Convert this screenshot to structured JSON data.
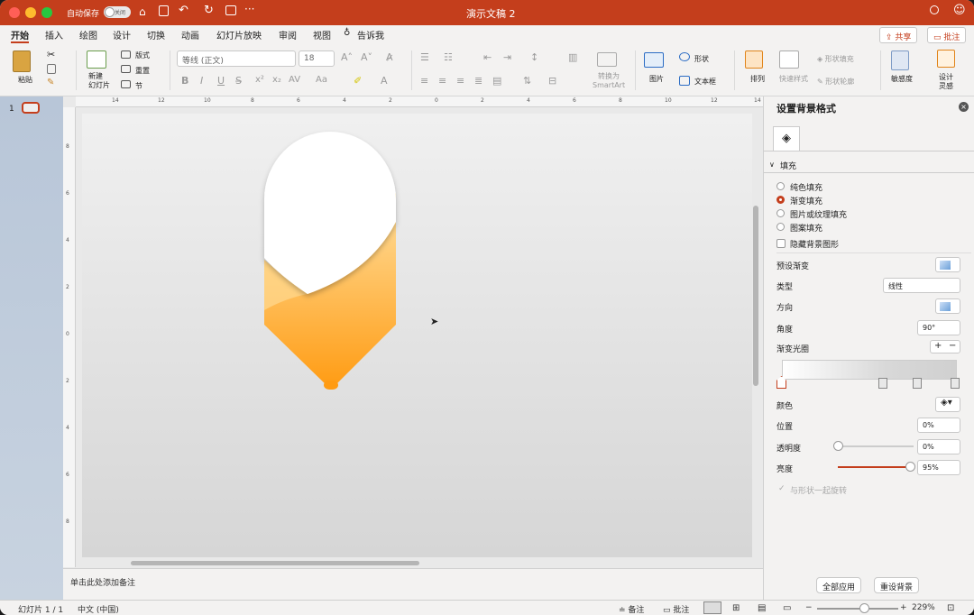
{
  "titlebar": {
    "autosave_label": "自动保存",
    "autosave_state": "关闭",
    "document_title": "演示文稿 2"
  },
  "tabs": [
    "开始",
    "插入",
    "绘图",
    "设计",
    "切换",
    "动画",
    "幻灯片放映",
    "审阅",
    "视图",
    "告诉我"
  ],
  "actions": {
    "share": "共享",
    "comments": "批注"
  },
  "ribbon": {
    "paste": "粘贴",
    "new_slide": "新建\n幻灯片",
    "layout": "版式",
    "reset": "重置",
    "section": "节",
    "font_name": "等线 (正文)",
    "font_size": "18",
    "convert_smartart": "转换为\nSmartArt",
    "picture": "图片",
    "shape": "形状",
    "textbox": "文本框",
    "arrange": "排列",
    "quick_styles": "快速样式",
    "shape_fill": "形状填充",
    "shape_outline": "形状轮廓",
    "sensitivity": "敏感度",
    "designer": "设计\n灵感"
  },
  "thumbnail_number": "1",
  "ruler_top": [
    "14",
    "12",
    "10",
    "8",
    "6",
    "4",
    "2",
    "0",
    "2",
    "4",
    "6",
    "8",
    "10",
    "12",
    "14"
  ],
  "ruler_left": [
    "8",
    "6",
    "4",
    "2",
    "0",
    "2",
    "4",
    "6",
    "8"
  ],
  "notes_placeholder": "单击此处添加备注",
  "format_pane": {
    "title": "设置背景格式",
    "section": "填充",
    "fill_options": [
      "纯色填充",
      "渐变填充",
      "图片或纹理填充",
      "图案填充"
    ],
    "selected_fill": "渐变填充",
    "hide_bg": "隐藏背景图形",
    "preset_gradient": "预设渐变",
    "type_label": "类型",
    "type_value": "线性",
    "direction_label": "方向",
    "angle_label": "角度",
    "angle_value": "90°",
    "stops_label": "渐变光圈",
    "color_label": "颜色",
    "position_label": "位置",
    "position_value": "0%",
    "transparency_label": "透明度",
    "transparency_value": "0%",
    "transparency_level": 0,
    "brightness_label": "亮度",
    "brightness_value": "95%",
    "brightness_level": 0.95,
    "rotate_with_shape": "与形状一起旋转",
    "apply_all": "全部应用",
    "reset_bg": "重设背景"
  },
  "status": {
    "slide_counter": "幻灯片 1 / 1",
    "language": "中文 (中国)",
    "notes": "备注",
    "comments": "批注",
    "zoom": "229%"
  },
  "colors": {
    "accent": "#c43e1c",
    "shape_top": "#ffd98a",
    "shape_bottom": "#ff9d14"
  }
}
